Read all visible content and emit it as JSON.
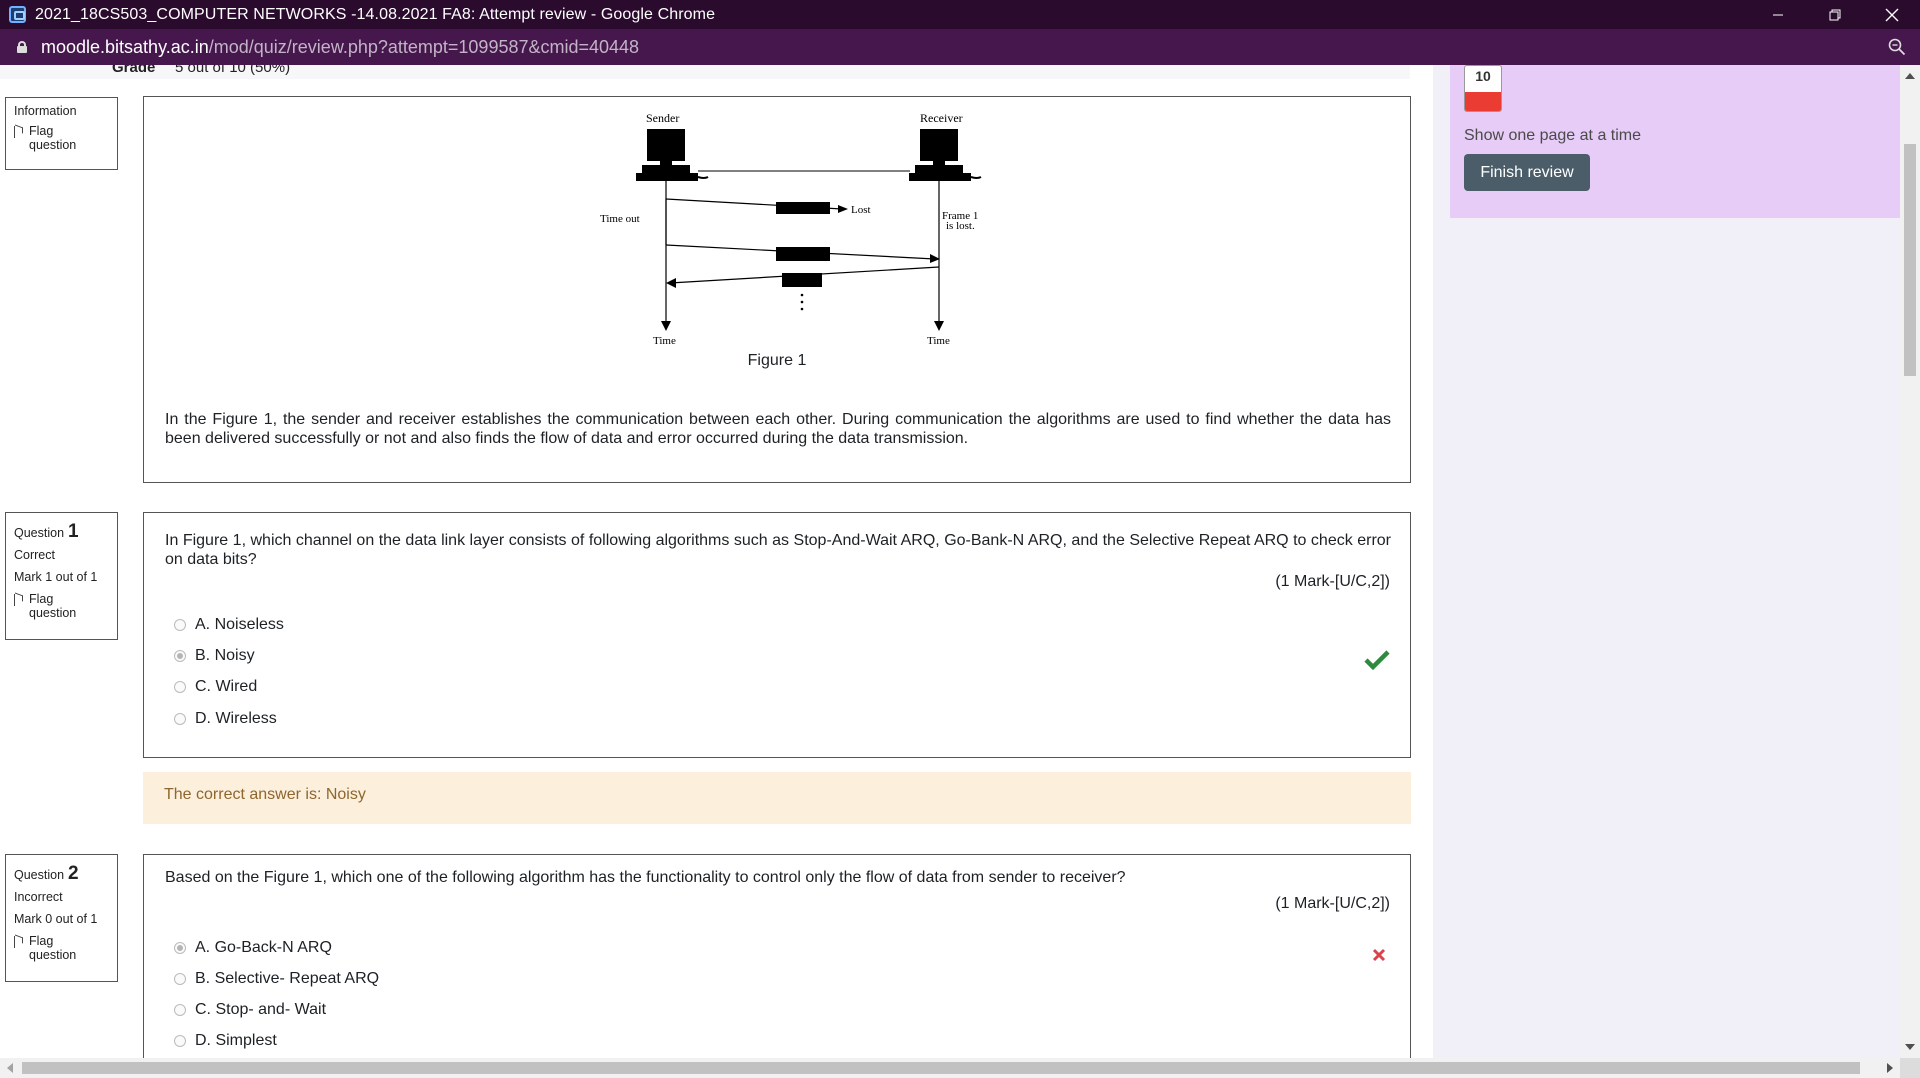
{
  "window": {
    "title": "2021_18CS503_COMPUTER NETWORKS -14.08.2021 FA8: Attempt review - Google Chrome",
    "minimize_icon": "minimize-icon",
    "restore_icon": "restore-icon",
    "close_icon": "close-icon"
  },
  "address": {
    "host": "moodle.bitsathy.ac.in",
    "path": "/mod/quiz/review.php?attempt=1099587&cmid=40448"
  },
  "summary": {
    "grade_label": "Grade",
    "grade_value": "5 out of 10 (50%)"
  },
  "info_block": {
    "title": "Information",
    "flag_label": "Flag question"
  },
  "figure": {
    "sender_label": "Sender",
    "receiver_label": "Receiver",
    "timeout_label": "Time out",
    "lost_label": "Lost",
    "frame_lost_line1": "Frame 1",
    "frame_lost_line2": "is lost.",
    "time_left": "Time",
    "time_right": "Time",
    "caption": "Figure 1",
    "description": "In the Figure 1, the sender and receiver establishes the communication between each other. During communication the algorithms are used to find whether the data has been delivered successfully or not and also finds the flow of data and error occurred during the data transmission."
  },
  "questions": [
    {
      "label": "Question",
      "number": "1",
      "state": "Correct",
      "mark": "Mark 1 out of 1",
      "flag_label": "Flag question",
      "text": "In Figure 1, which channel on the data link layer consists of following algorithms such as Stop-And-Wait ARQ, Go-Bank-N ARQ, and the Selective Repeat ARQ to check error on data bits?",
      "marks_info": "(1 Mark-[U/C,2])",
      "options": [
        "A. Noiseless",
        "B. Noisy",
        "C. Wired",
        "D. Wireless"
      ],
      "selected_index": 1,
      "result_icon": "checkmark-icon",
      "feedback": "The correct answer is: Noisy"
    },
    {
      "label": "Question",
      "number": "2",
      "state": "Incorrect",
      "mark": "Mark 0 out of 1",
      "flag_label": "Flag question",
      "text": "Based on the Figure 1, which one of the following algorithm has the functionality to control only the flow of data from sender to receiver?",
      "marks_info": "(1 Mark-[U/C,2])",
      "options": [
        "A. Go-Back-N ARQ",
        "B. Selective- Repeat ARQ",
        "C. Stop- and- Wait",
        "D. Simplest"
      ],
      "selected_index": 0,
      "result_icon": "cross-icon"
    }
  ],
  "quiz_nav": {
    "button_number": "10",
    "show_one_page": "Show one page at a time",
    "finish_review": "Finish review"
  },
  "colors": {
    "titlebar": "#2a0b2e",
    "addressbar": "#46174d",
    "nav_panel": "#e6ccf7",
    "finish_button": "#4b5d69",
    "correct": "#2e8b3e",
    "incorrect": "#d9434e",
    "feedback_bg": "#fcefdc",
    "feedback_text": "#8e662e"
  }
}
